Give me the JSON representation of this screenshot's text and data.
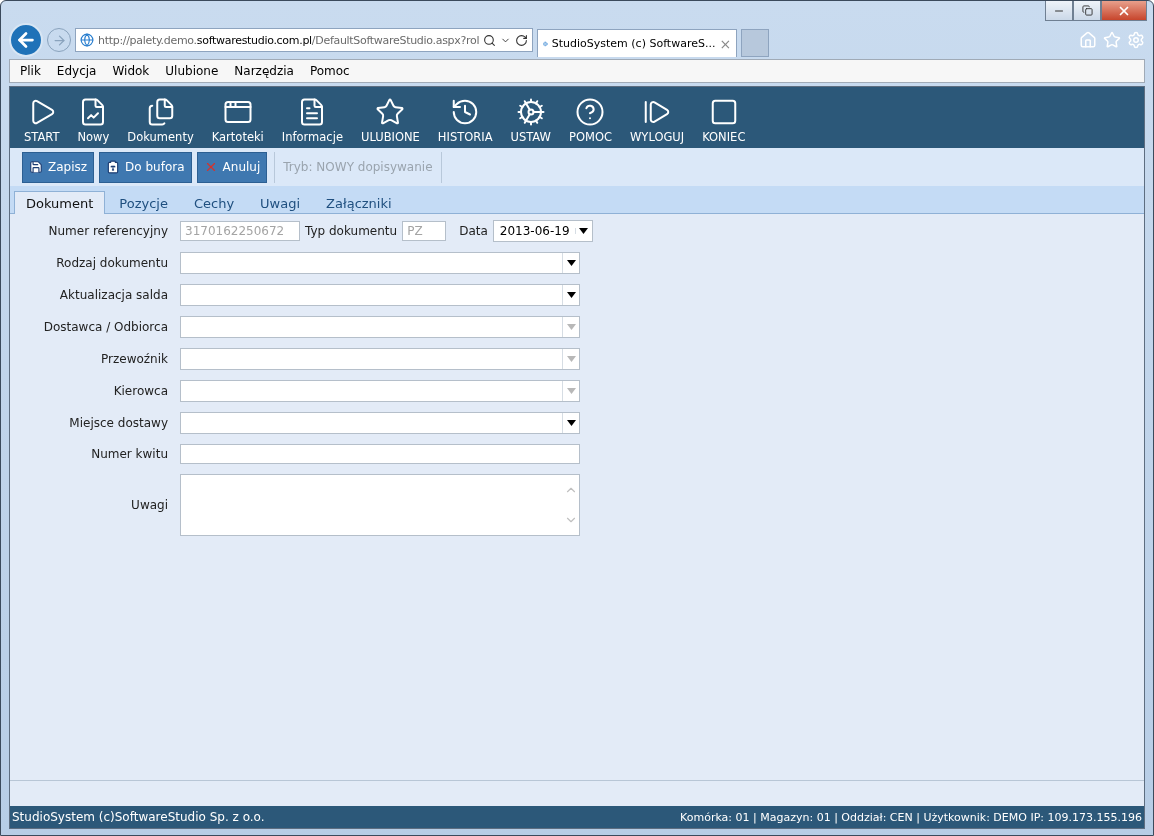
{
  "browser": {
    "address": "http://palety.demo.**softwarestudio.com.pl**/DefaultSoftwareStudio.aspx?rol",
    "tab_title": "StudioSystem (c) SoftwareS...",
    "tab_close": "×",
    "menu": [
      "Plik",
      "Edycja",
      "Widok",
      "Ulubione",
      "Narzędzia",
      "Pomoc"
    ]
  },
  "toolbar": {
    "items": [
      {
        "label": "START"
      },
      {
        "label": "Nowy"
      },
      {
        "label": "Dokumenty"
      },
      {
        "label": "Kartoteki"
      },
      {
        "label": "Informacje"
      },
      {
        "label": "ULUBIONE"
      },
      {
        "label": "HISTORIA"
      },
      {
        "label": "USTAW"
      },
      {
        "label": "POMOC"
      },
      {
        "label": "WYLOGUJ"
      },
      {
        "label": "KONIEC"
      }
    ]
  },
  "actions": {
    "buttons": [
      {
        "label": "Zapisz"
      },
      {
        "label": "Do bufora"
      },
      {
        "label": "Anuluj"
      }
    ],
    "mode": "Tryb: NOWY dopisywanie"
  },
  "tabs": [
    {
      "label": "Dokument",
      "selected": true
    },
    {
      "label": "Pozycje",
      "selected": false
    },
    {
      "label": "Cechy",
      "selected": false
    },
    {
      "label": "Uwagi",
      "selected": false
    },
    {
      "label": "Załączniki",
      "selected": false
    }
  ],
  "form": {
    "header": {
      "ref_label": "Numer referencyjny",
      "ref_value": "3170162250672",
      "type_label": "Typ dokumentu",
      "type_value": "PZ",
      "date_label": "Data",
      "date_value": "2013-06-19"
    },
    "rows": [
      {
        "label": "Rodzaj dokumentu",
        "kind": "combo",
        "disabled": false
      },
      {
        "label": "Aktualizacja salda",
        "kind": "combo",
        "disabled": false
      },
      {
        "label": "Dostawca / Odbiorca",
        "kind": "combo",
        "disabled": true
      },
      {
        "label": "Przewoźnik",
        "kind": "combo",
        "disabled": true
      },
      {
        "label": "Kierowca",
        "kind": "combo",
        "disabled": true
      },
      {
        "label": "Miejsce dostawy",
        "kind": "combo",
        "disabled": false
      },
      {
        "label": "Numer kwitu",
        "kind": "text"
      },
      {
        "label": "Uwagi",
        "kind": "memo"
      }
    ]
  },
  "status_bar": {
    "left": "StudioSystem (c)SoftwareStudio Sp. z o.o.",
    "right": "Komórka: 01 | Magazyn: 01 | Oddział: CEN | Użytkownik: DEMO IP: 109.173.155.196"
  }
}
